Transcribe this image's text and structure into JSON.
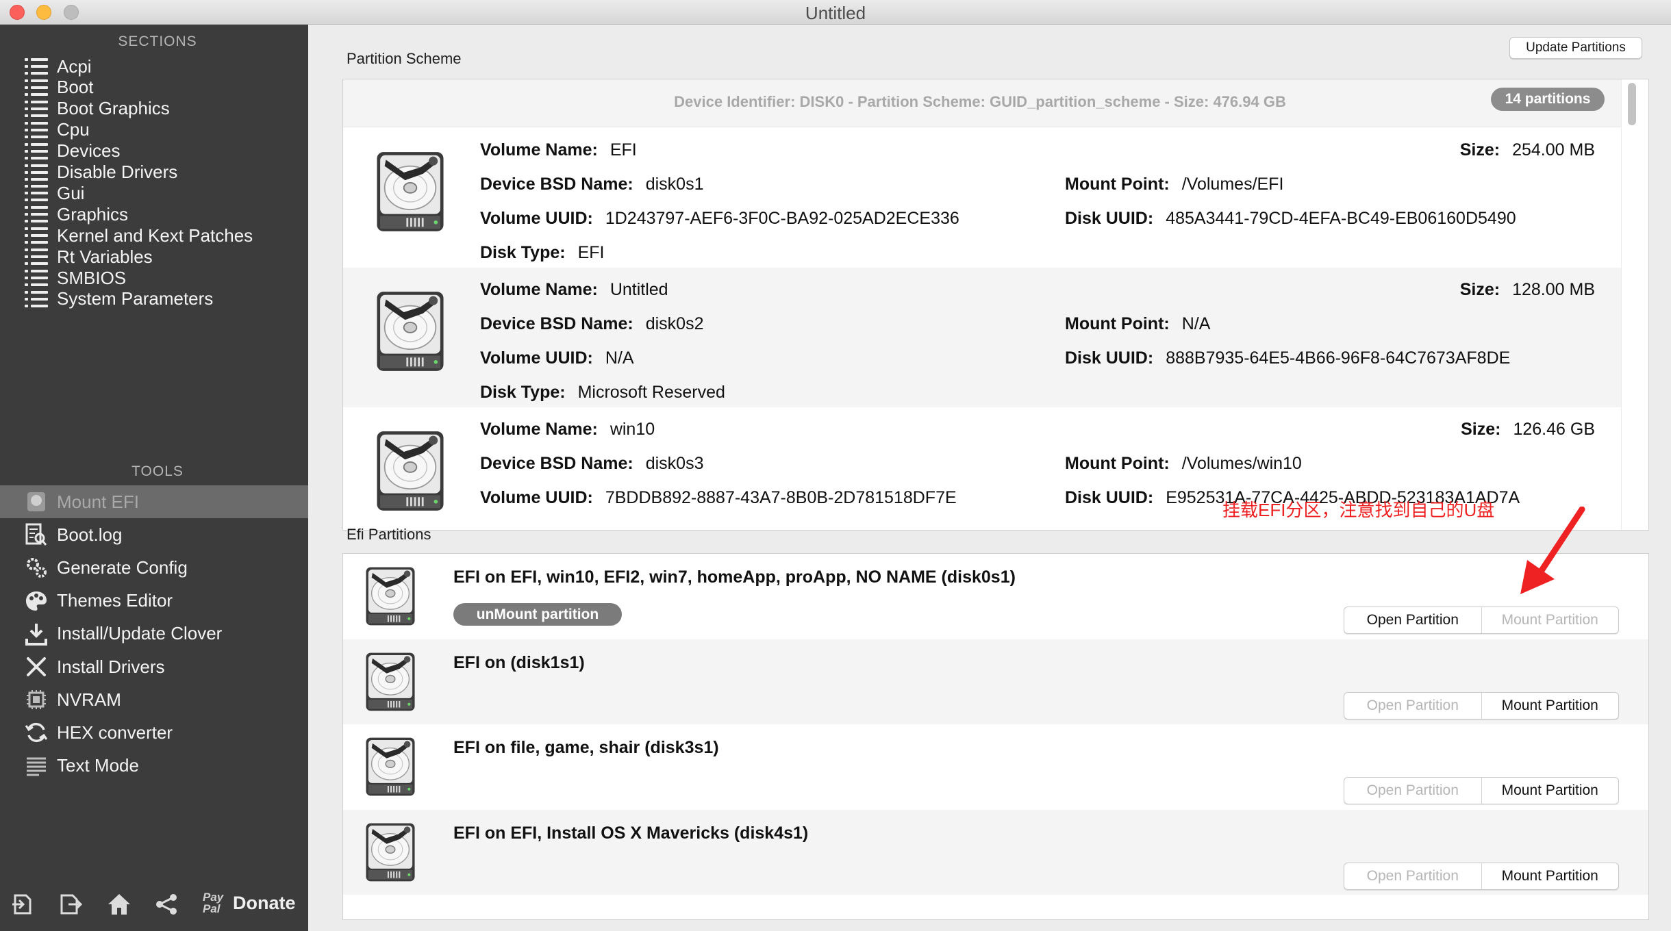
{
  "window": {
    "title": "Untitled"
  },
  "sidebar": {
    "sections_heading": "SECTIONS",
    "sections": [
      {
        "label": "Acpi",
        "icon": "list-icon"
      },
      {
        "label": "Boot",
        "icon": "list-icon"
      },
      {
        "label": "Boot Graphics",
        "icon": "list-icon"
      },
      {
        "label": "Cpu",
        "icon": "list-icon"
      },
      {
        "label": "Devices",
        "icon": "list-icon"
      },
      {
        "label": "Disable Drivers",
        "icon": "list-icon"
      },
      {
        "label": "Gui",
        "icon": "list-icon"
      },
      {
        "label": "Graphics",
        "icon": "list-icon"
      },
      {
        "label": "Kernel and Kext Patches",
        "icon": "list-icon"
      },
      {
        "label": "Rt Variables",
        "icon": "list-icon"
      },
      {
        "label": "SMBIOS",
        "icon": "list-icon"
      },
      {
        "label": "System Parameters",
        "icon": "list-icon"
      }
    ],
    "tools_heading": "TOOLS",
    "tools": [
      {
        "label": "Mount EFI",
        "icon": "disk-icon",
        "selected": true
      },
      {
        "label": "Boot.log",
        "icon": "log-search-icon"
      },
      {
        "label": "Generate Config",
        "icon": "gears-icon"
      },
      {
        "label": "Themes Editor",
        "icon": "palette-icon"
      },
      {
        "label": "Install/Update Clover",
        "icon": "download-icon"
      },
      {
        "label": "Install Drivers",
        "icon": "tools-icon"
      },
      {
        "label": "NVRAM",
        "icon": "chip-icon"
      },
      {
        "label": "HEX converter",
        "icon": "refresh-icon"
      },
      {
        "label": "Text Mode",
        "icon": "text-lines-icon"
      }
    ],
    "footer": {
      "paypal_text": "Pay Pal",
      "donate_label": "Donate"
    }
  },
  "partition_scheme": {
    "group_label": "Partition Scheme",
    "update_button": "Update Partitions",
    "device_info": "Device Identifier: DISK0 - Partition Scheme: GUID_partition_scheme - Size: 476.94 GB",
    "badge": "14 partitions",
    "labels": {
      "volume_name": "Volume Name:",
      "device_bsd_name": "Device BSD Name:",
      "volume_uuid": "Volume UUID:",
      "disk_type": "Disk Type:",
      "size": "Size:",
      "mount_point": "Mount Point:",
      "disk_uuid": "Disk UUID:"
    },
    "partitions": [
      {
        "volume_name": "EFI",
        "device_bsd_name": "disk0s1",
        "volume_uuid": "1D243797-AEF6-3F0C-BA92-025AD2ECE336",
        "disk_type": "EFI",
        "size": "254.00 MB",
        "mount_point": "/Volumes/EFI",
        "disk_uuid": "485A3441-79CD-4EFA-BC49-EB06160D5490"
      },
      {
        "volume_name": "Untitled",
        "device_bsd_name": "disk0s2",
        "volume_uuid": "N/A",
        "disk_type": "Microsoft Reserved",
        "size": "128.00 MB",
        "mount_point": "N/A",
        "disk_uuid": "888B7935-64E5-4B66-96F8-64C7673AF8DE"
      },
      {
        "volume_name": "win10",
        "device_bsd_name": "disk0s3",
        "volume_uuid": "7BDDB892-8887-43A7-8B0B-2D781518DF7E",
        "disk_type": "",
        "size": "126.46 GB",
        "mount_point": "/Volumes/win10",
        "disk_uuid": "E952531A-77CA-4425-ABDD-523183A1AD7A"
      }
    ]
  },
  "efi_partitions": {
    "group_label": "Efi Partitions",
    "open_label": "Open Partition",
    "mount_label": "Mount Partition",
    "unmount_label": "unMount partition",
    "items": [
      {
        "title": "EFI on EFI, win10, EFI2, win7, homeApp, proApp, NO NAME (disk0s1)",
        "mounted": true
      },
      {
        "title": "EFI on  (disk1s1)",
        "mounted": false
      },
      {
        "title": "EFI on file, game, shair (disk3s1)",
        "mounted": false
      },
      {
        "title": "EFI on EFI, Install OS X Mavericks (disk4s1)",
        "mounted": false
      }
    ]
  },
  "annotation": {
    "text": "挂载EFI分区，注意找到自己的U盘",
    "color": "#ee2222"
  },
  "colors": {
    "sidebar_bg": "#3c3c3c",
    "selected_bg": "#6b6b6b",
    "pill_bg": "#7b7b7b"
  }
}
